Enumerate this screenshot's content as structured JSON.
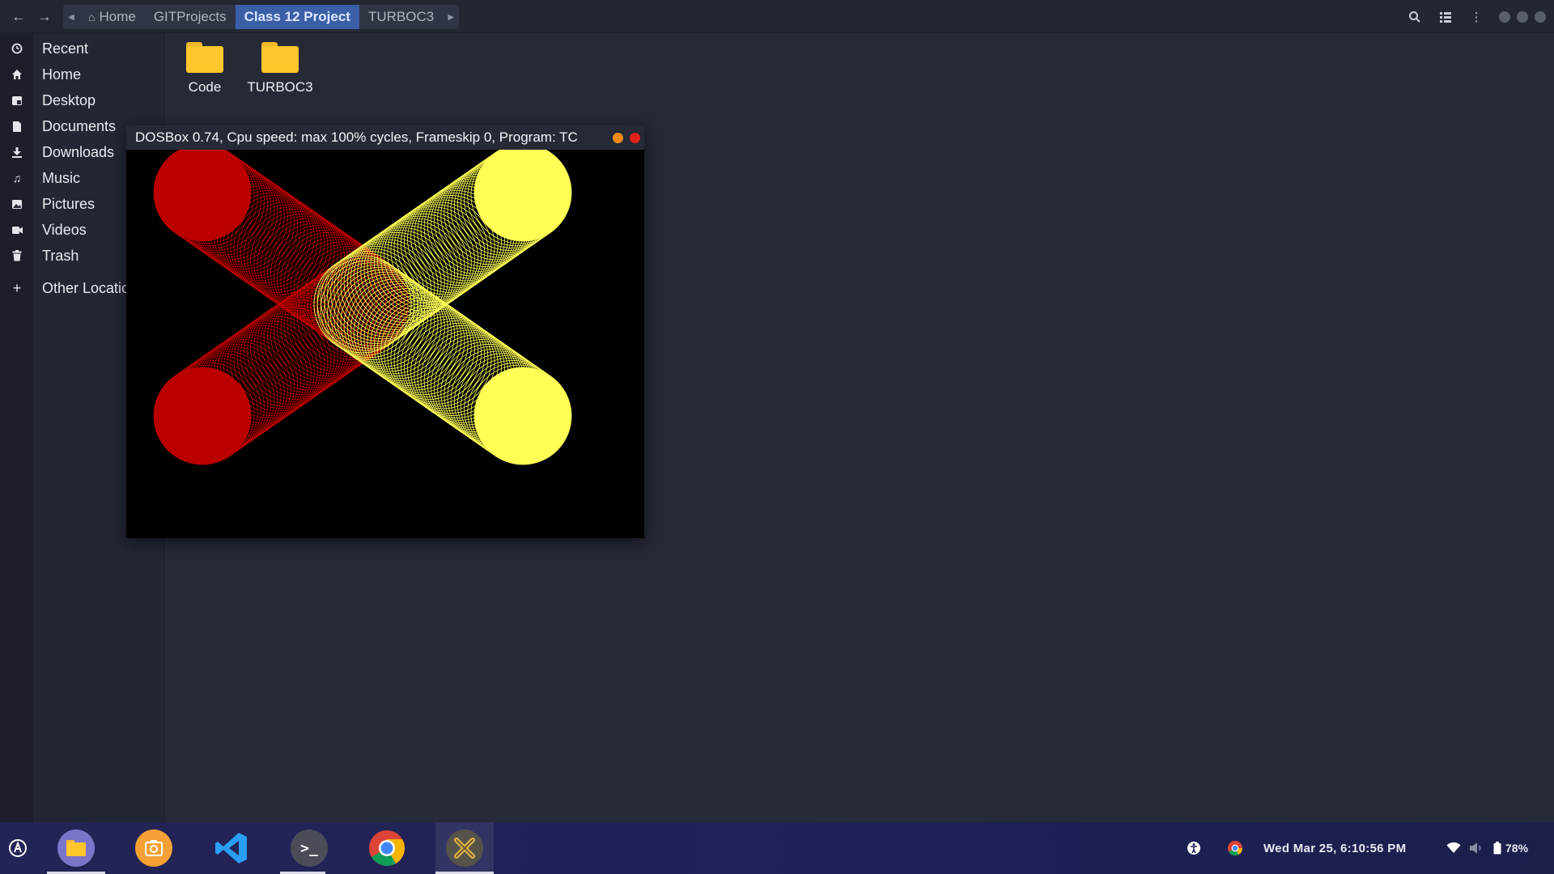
{
  "headerbar": {
    "back_icon": "arrow-left-icon",
    "forward_icon": "arrow-right-icon",
    "path": [
      {
        "label": "Home",
        "icon": "home-icon"
      },
      {
        "label": "GITProjects"
      },
      {
        "label": "Class 12 Project",
        "active": true
      },
      {
        "label": "TURBOC3"
      }
    ],
    "actions": [
      "search-icon",
      "view-toggle-icon",
      "menu-icon"
    ]
  },
  "sidebar": {
    "items": [
      {
        "label": "Recent",
        "icon": "clock-icon"
      },
      {
        "label": "Home",
        "icon": "home-icon"
      },
      {
        "label": "Desktop",
        "icon": "desktop-icon"
      },
      {
        "label": "Documents",
        "icon": "document-icon"
      },
      {
        "label": "Downloads",
        "icon": "download-icon"
      },
      {
        "label": "Music",
        "icon": "music-icon"
      },
      {
        "label": "Pictures",
        "icon": "picture-icon"
      },
      {
        "label": "Videos",
        "icon": "video-icon"
      },
      {
        "label": "Trash",
        "icon": "trash-icon"
      },
      {
        "label": "Other Locatic",
        "icon": "plus-icon"
      }
    ]
  },
  "files": [
    {
      "name": "Code"
    },
    {
      "name": "TURBOC3"
    }
  ],
  "dosbox": {
    "title": "DOSBox 0.74, Cpu speed: max 100% cycles, Frameskip  0, Program:     TC",
    "colors": {
      "red": "#bb0000",
      "yellow": "#ffff55",
      "minimize": "#f28a14",
      "close": "#e0221a"
    }
  },
  "taskbar": {
    "apps": [
      "files-app-icon",
      "screenshot-app-icon",
      "vscode-app-icon",
      "terminal-app-icon",
      "chrome-app-icon",
      "dosbox-app-icon"
    ],
    "clock": "Wed Mar 25,  6:10:56 PM",
    "battery": "78%"
  }
}
